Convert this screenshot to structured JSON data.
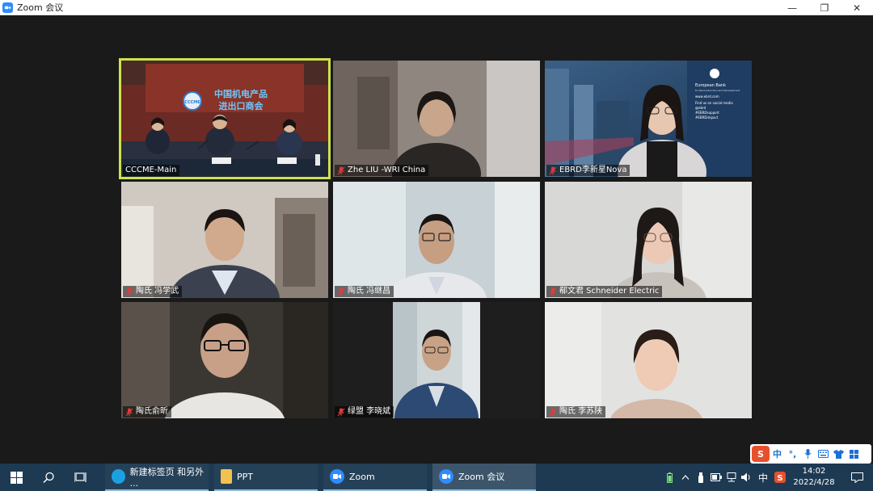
{
  "window": {
    "title": "Zoom 会议",
    "minimize": "—",
    "restore": "❐",
    "close": "✕"
  },
  "participants": [
    {
      "name": "CCCME-Main",
      "muted": false,
      "active": true
    },
    {
      "name": "Zhe LIU -WRI China",
      "muted": true,
      "active": false
    },
    {
      "name": "EBRD李新星Nova",
      "muted": true,
      "active": false
    },
    {
      "name": "陶氏 冯学武",
      "muted": true,
      "active": false
    },
    {
      "name": "陶氏 冯继昌",
      "muted": true,
      "active": false
    },
    {
      "name": "郗文君 Schneider Electric",
      "muted": true,
      "active": false
    },
    {
      "name": "陶氏俞昕",
      "muted": true,
      "active": false
    },
    {
      "name": "绿盟 李晓斌",
      "muted": true,
      "active": false
    },
    {
      "name": "陶氏 李苏陕",
      "muted": true,
      "active": false
    }
  ],
  "room_sign": {
    "line1": "中国机电产品",
    "line2": "进出口商会",
    "logo": "CCCME"
  },
  "ebrd_slide": {
    "bank": "European Bank",
    "sub": "for Reconstruction and Development",
    "lines": [
      "www.ebrd.com",
      "Find us on social media",
      "@ebrd",
      "#EBRDsupport",
      "#EBRDimpact"
    ]
  },
  "taskbar": {
    "apps": [
      {
        "label": "新建标签页 和另外 ...",
        "icon": "edge-icon",
        "color": "#1ba1e2"
      },
      {
        "label": "PPT",
        "icon": "folder-icon",
        "color": "#f2c14e"
      },
      {
        "label": "Zoom",
        "icon": "zoom-icon",
        "color": "#2d8cff"
      },
      {
        "label": "Zoom 会议",
        "icon": "zoom-icon",
        "color": "#2d8cff"
      }
    ],
    "ime_indicator": "中",
    "time": "14:02",
    "date": "2022/4/28"
  },
  "ime_toolbar": {
    "lang": "中"
  },
  "colors": {
    "active_speaker": "#cfe24a",
    "zoom_blue": "#2d8cff",
    "taskbar": "#1d3a52"
  }
}
